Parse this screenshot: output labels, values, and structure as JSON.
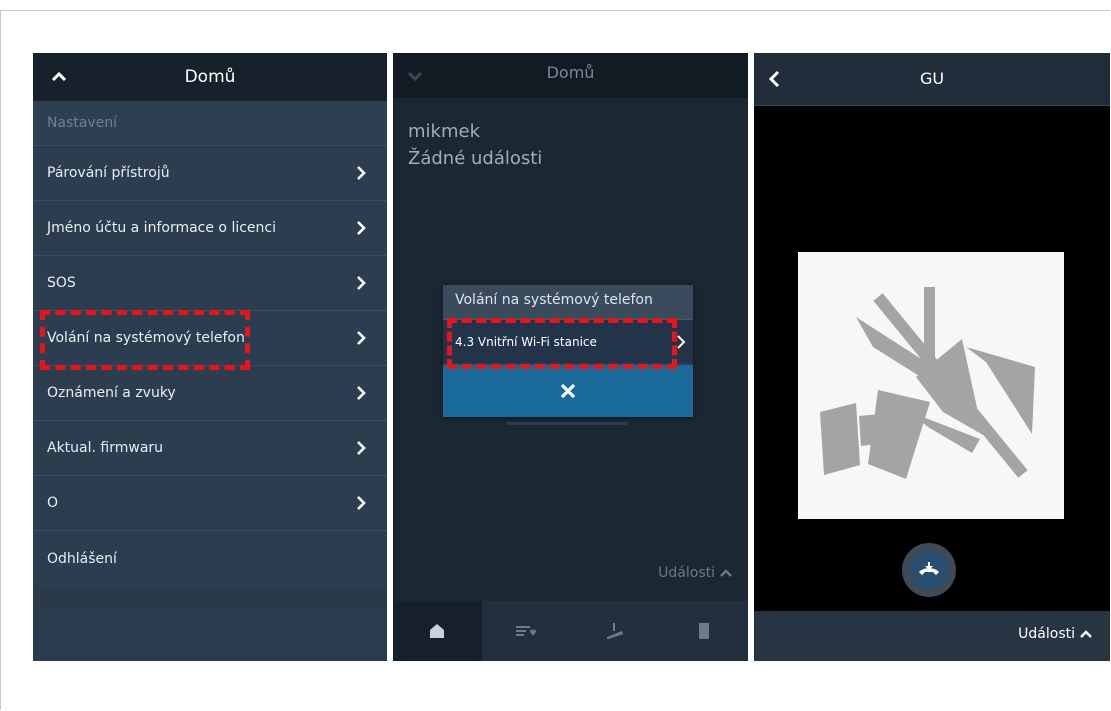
{
  "settings_screen": {
    "header_title": "Domů",
    "section_label": "Nastavení",
    "items": [
      {
        "label": "Párování přístrojů"
      },
      {
        "label": "Jméno účtu a informace o licenci"
      },
      {
        "label": "SOS"
      },
      {
        "label": "Volání na systémový telefon"
      },
      {
        "label": "Oznámení a zvuky"
      },
      {
        "label": "Aktual. firmwaru"
      },
      {
        "label": "O"
      }
    ],
    "logout_label": "Odhlášení"
  },
  "home_screen": {
    "header_title": "Domů",
    "account_name": "mikmek",
    "no_events_text": "Žádné události",
    "dialog": {
      "title": "Volání na systémový telefon",
      "option_label": "4.3 Vnitřní Wi-Fi stanice"
    },
    "events_label": "Události",
    "tabs": [
      {
        "icon": "home-icon"
      },
      {
        "icon": "favorites-list-icon"
      },
      {
        "icon": "camera-icon"
      },
      {
        "icon": "door-icon"
      }
    ]
  },
  "call_screen": {
    "header_title": "GU",
    "events_label": "Události"
  },
  "colors": {
    "highlight": "#e8141b",
    "accent_blue": "#1a6a99",
    "panel_bg": "#2c3d50"
  }
}
